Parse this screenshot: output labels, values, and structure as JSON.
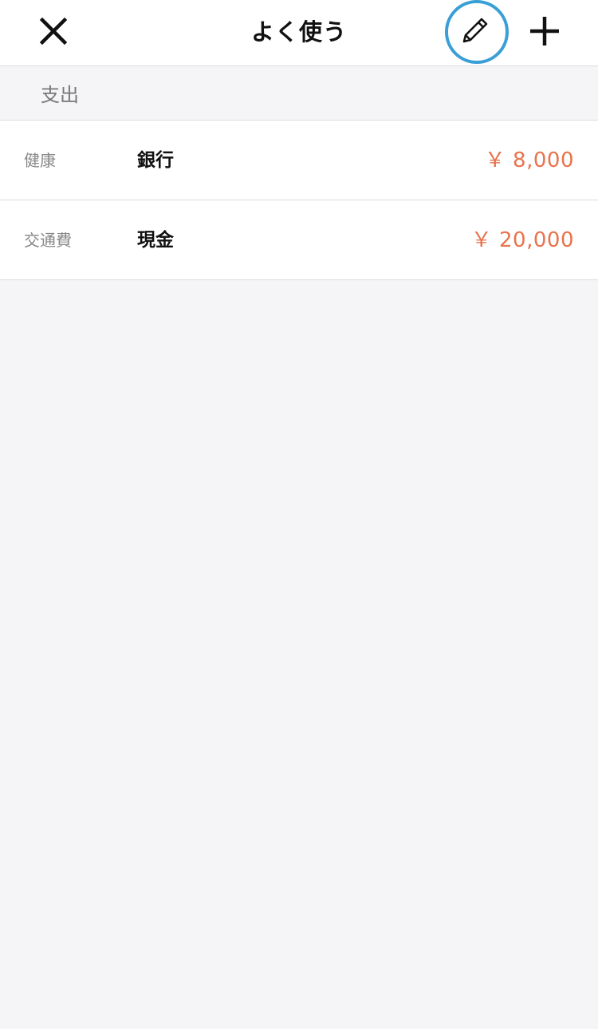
{
  "header": {
    "title": "よく使う",
    "close_icon": "close-icon",
    "edit_icon": "pencil-icon",
    "add_icon": "plus-icon",
    "highlight_color": "#3a9fd6"
  },
  "section": {
    "label": "支出"
  },
  "rows": [
    {
      "category": "健康",
      "account": "銀行",
      "amount": "￥ 8,000"
    },
    {
      "category": "交通費",
      "account": "現金",
      "amount": "￥ 20,000"
    }
  ],
  "colors": {
    "amount": "#e8734c",
    "background": "#f5f5f7"
  }
}
